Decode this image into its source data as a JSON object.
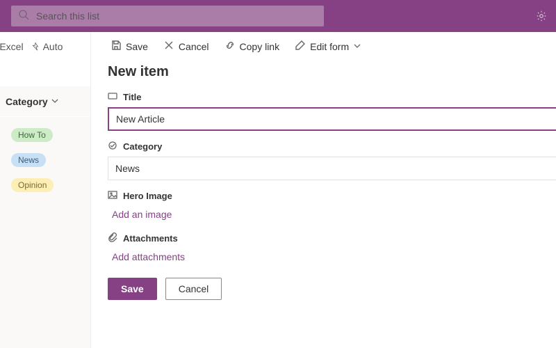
{
  "topbar": {
    "search_placeholder": "Search this list"
  },
  "bgcmd": {
    "export": "t to Excel",
    "automate": "Auto"
  },
  "bgcol": {
    "title": "Category",
    "pills": {
      "howto": "How To",
      "news": "News",
      "opinion": "Opinion"
    }
  },
  "panel": {
    "cmd": {
      "save": "Save",
      "cancel": "Cancel",
      "copylink": "Copy link",
      "editform": "Edit form"
    },
    "heading": "New item",
    "fields": {
      "title_label": "Title",
      "title_value": "New Article",
      "category_label": "Category",
      "category_value": "News",
      "hero_label": "Hero Image",
      "hero_action": "Add an image",
      "attach_label": "Attachments",
      "attach_action": "Add attachments"
    },
    "footer": {
      "save": "Save",
      "cancel": "Cancel"
    }
  }
}
